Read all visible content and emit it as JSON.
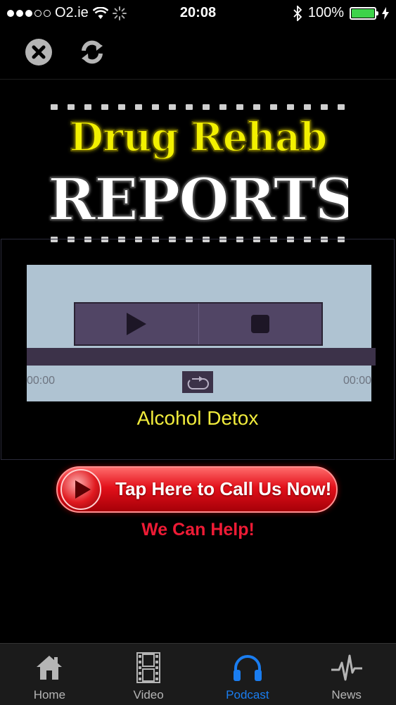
{
  "status_bar": {
    "carrier": "O2.ie",
    "time": "20:08",
    "battery": "100%",
    "colors": {
      "battery_fill": "#3dd34a"
    }
  },
  "toolbar": {
    "close_icon": "close-icon",
    "refresh_icon": "refresh-icon"
  },
  "logo": {
    "line1": "Drug Rehab",
    "line2": "REPORTS",
    "colors": {
      "line1": "#f2f000",
      "line2": "#ffffff"
    }
  },
  "player": {
    "time_elapsed": "00:00",
    "time_total": "00:00",
    "track_title": "Alcohol Detox",
    "progress": 0,
    "colors": {
      "background": "#afc3d2",
      "controls": "#514565",
      "title": "#f1ec3c"
    }
  },
  "call_to_action": {
    "button_label": "Tap Here to Call Us Now!",
    "subtitle": "We Can Help!",
    "colors": {
      "button": "#e3101a",
      "subtitle": "#ee1b35"
    }
  },
  "tab_bar": {
    "tabs": [
      {
        "label": "Home",
        "icon": "home-icon",
        "active": false
      },
      {
        "label": "Video",
        "icon": "film-icon",
        "active": false
      },
      {
        "label": "Podcast",
        "icon": "headphones-icon",
        "active": true
      },
      {
        "label": "News",
        "icon": "pulse-icon",
        "active": false
      }
    ],
    "colors": {
      "active": "#1a7df0",
      "inactive": "#b5b5b5"
    }
  }
}
